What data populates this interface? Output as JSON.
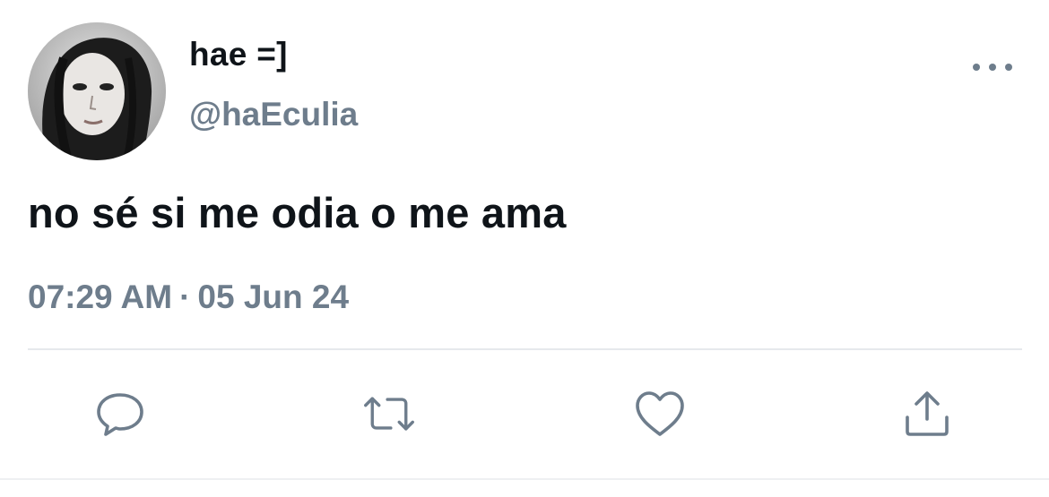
{
  "tweet": {
    "display_name": "hae =]",
    "handle": "@haEculia",
    "text": "no sé si me odia o me ama",
    "time": "07:29 AM",
    "separator": "·",
    "date": "05 Jun 24"
  },
  "actions": {
    "reply_icon": "speech-bubble-icon",
    "retweet_icon": "retweet-arrows-icon",
    "like_icon": "heart-icon",
    "share_icon": "upload-arrow-icon"
  },
  "colors": {
    "text": "#0f1419",
    "secondary": "#6e7d8c",
    "divider": "#e6e9ec"
  }
}
